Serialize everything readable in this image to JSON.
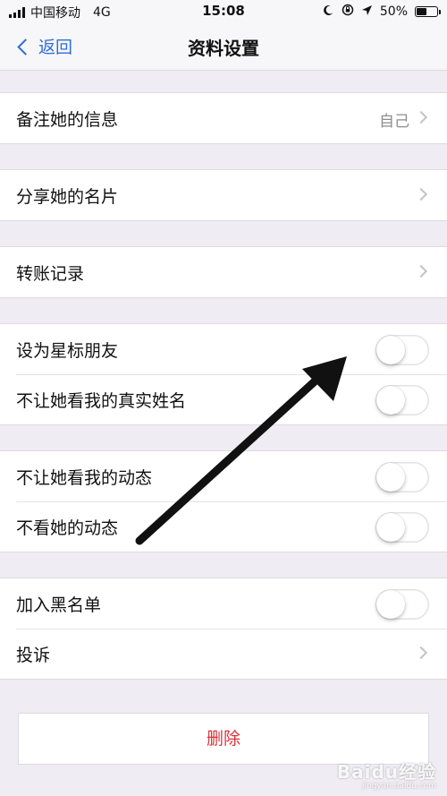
{
  "status_bar": {
    "carrier": "中国移动",
    "network": "4G",
    "time": "15:08",
    "battery": "50%",
    "battery_level": 0.5,
    "icons": [
      "signal-icon",
      "moon-icon",
      "rotation-lock-icon",
      "location-icon",
      "battery-icon"
    ]
  },
  "nav": {
    "back_label": "返回",
    "title": "资料设置"
  },
  "groups": [
    {
      "rows": [
        {
          "label": "备注她的信息",
          "value": "自己",
          "type": "arrow"
        }
      ]
    },
    {
      "rows": [
        {
          "label": "分享她的名片",
          "type": "arrow"
        }
      ]
    },
    {
      "rows": [
        {
          "label": "转账记录",
          "type": "arrow"
        }
      ]
    },
    {
      "rows": [
        {
          "label": "设为星标朋友",
          "type": "toggle",
          "on": false
        },
        {
          "label": "不让她看我的真实姓名",
          "type": "toggle",
          "on": false
        }
      ]
    },
    {
      "rows": [
        {
          "label": "不让她看我的动态",
          "type": "toggle",
          "on": false
        },
        {
          "label": "不看她的动态",
          "type": "toggle",
          "on": false
        }
      ]
    },
    {
      "rows": [
        {
          "label": "加入黑名单",
          "type": "toggle",
          "on": false
        },
        {
          "label": "投诉",
          "type": "arrow"
        }
      ]
    }
  ],
  "delete_label": "删除",
  "watermark": {
    "text": "Baidu经验",
    "sub": "jingyan.baidu.com"
  },
  "colors": {
    "accent": "#2f6fd6",
    "danger": "#d8323b",
    "background": "#efedf3"
  }
}
